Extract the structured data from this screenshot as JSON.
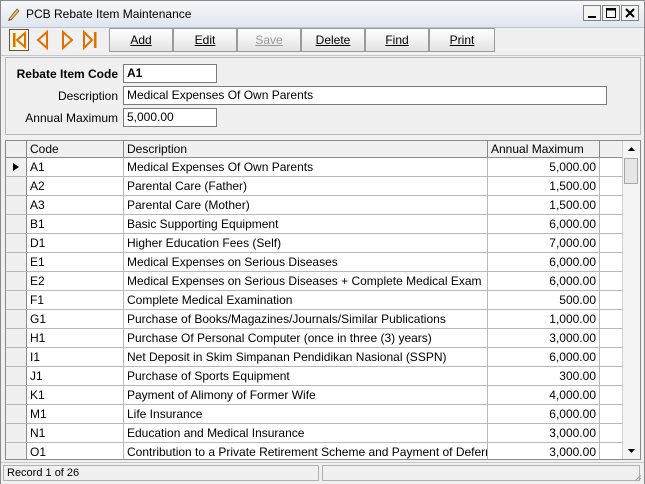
{
  "window": {
    "title": "PCB Rebate Item Maintenance",
    "app_icon": "pencil-icon",
    "controls": [
      "minimize-icon",
      "maximize-icon",
      "close-icon"
    ]
  },
  "toolbar": {
    "nav_icons": [
      "first-record-icon",
      "previous-record-icon",
      "next-record-icon",
      "last-record-icon"
    ],
    "add_label": "Add",
    "edit_label": "Edit",
    "save_label": "Save",
    "delete_label": "Delete",
    "find_label": "Find",
    "print_label": "Print",
    "accent_color": "#e07000"
  },
  "form": {
    "code_label": "Rebate Item Code",
    "code_value": "A1",
    "description_label": "Description",
    "description_value": "Medical Expenses Of Own Parents",
    "annual_max_label": "Annual Maximum",
    "annual_max_value": "5,000.00"
  },
  "grid": {
    "columns": [
      "Code",
      "Description",
      "Annual Maximum"
    ],
    "selected_row": 0,
    "rows": [
      {
        "code": "A1",
        "description": "Medical Expenses Of Own Parents",
        "max": "5,000.00"
      },
      {
        "code": "A2",
        "description": "Parental Care (Father)",
        "max": "1,500.00"
      },
      {
        "code": "A3",
        "description": "Parental Care (Mother)",
        "max": "1,500.00"
      },
      {
        "code": "B1",
        "description": "Basic Supporting Equipment",
        "max": "6,000.00"
      },
      {
        "code": "D1",
        "description": "Higher Education Fees (Self)",
        "max": "7,000.00"
      },
      {
        "code": "E1",
        "description": "Medical Expenses on Serious Diseases",
        "max": "6,000.00"
      },
      {
        "code": "E2",
        "description": "Medical Expenses on Serious Diseases + Complete Medical Exam",
        "max": "6,000.00"
      },
      {
        "code": "F1",
        "description": "Complete Medical Examination",
        "max": "500.00"
      },
      {
        "code": "G1",
        "description": "Purchase of Books/Magazines/Journals/Similar Publications",
        "max": "1,000.00"
      },
      {
        "code": "H1",
        "description": "Purchase Of Personal Computer (once in three (3) years)",
        "max": "3,000.00"
      },
      {
        "code": "I1",
        "description": "Net Deposit in Skim Simpanan Pendidikan Nasional (SSPN)",
        "max": "6,000.00"
      },
      {
        "code": "J1",
        "description": "Purchase of Sports Equipment",
        "max": "300.00"
      },
      {
        "code": "K1",
        "description": "Payment of Alimony of Former Wife",
        "max": "4,000.00"
      },
      {
        "code": "M1",
        "description": "Life Insurance",
        "max": "6,000.00"
      },
      {
        "code": "N1",
        "description": "Education and Medical Insurance",
        "max": "3,000.00"
      },
      {
        "code": "O1",
        "description": "Contribution to a Private Retirement Scheme and Payment of Deferred Annuity",
        "max": "3,000.00"
      }
    ]
  },
  "status": {
    "record_text": "Record 1 of 26"
  }
}
